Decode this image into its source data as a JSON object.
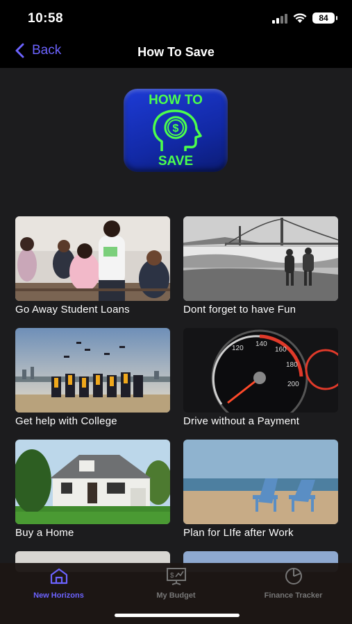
{
  "status": {
    "time": "10:58",
    "battery": "84"
  },
  "nav": {
    "back_label": "Back",
    "title": "How To Save"
  },
  "logo": {
    "line1": "HOW TO",
    "line2": "SAVE"
  },
  "cards": [
    {
      "label": "Go Away Student Loans"
    },
    {
      "label": "Dont forget to have Fun"
    },
    {
      "label": "Get help with College"
    },
    {
      "label": "Drive without a Payment"
    },
    {
      "label": "Buy a Home"
    },
    {
      "label": "Plan for LIfe after Work"
    }
  ],
  "tabs": [
    {
      "label": "New Horizons",
      "active": true
    },
    {
      "label": "My Budget",
      "active": false
    },
    {
      "label": "Finance Tracker",
      "active": false
    }
  ],
  "colors": {
    "accent": "#6c63ff",
    "background": "#1c1c1e",
    "logo_green": "#4cff4c",
    "logo_blue": "#1d3bd6"
  }
}
